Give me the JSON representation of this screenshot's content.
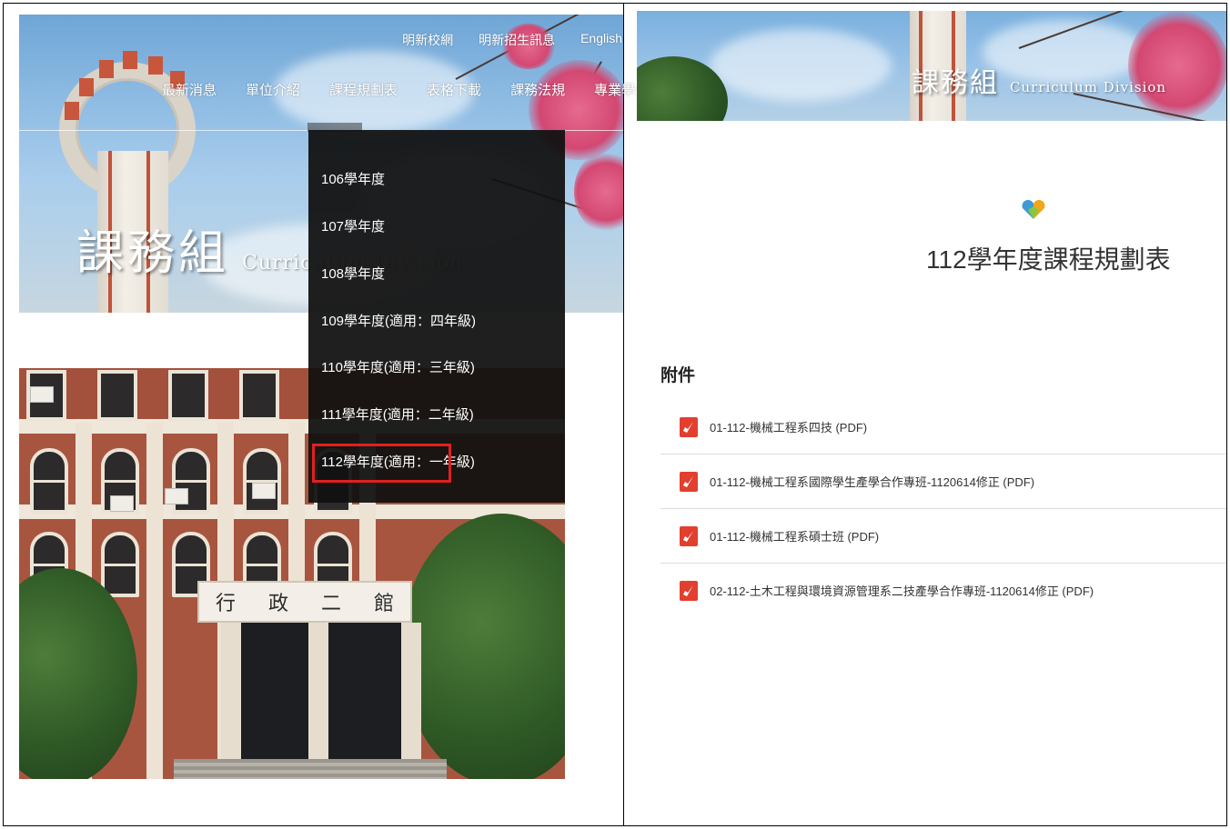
{
  "left_panel": {
    "utility_links": [
      "明新校網",
      "明新招生訊息",
      "English"
    ],
    "nav": [
      "最新消息",
      "單位介紹",
      "課程規劃表",
      "表格下載",
      "課務法規",
      "專業學分學程"
    ],
    "logo": {
      "cn": "課務組",
      "en": "Curriculum Division"
    },
    "dropdown": [
      "106學年度",
      "107學年度",
      "108學年度",
      "109學年度(適用：四年級)",
      "110學年度(適用：三年級)",
      "111學年度(適用：二年級)",
      "112學年度(適用：一年級)"
    ],
    "building_sign": [
      "行",
      "政",
      "二",
      "館"
    ]
  },
  "right_panel": {
    "logo": {
      "cn": "課務組",
      "en": "Curriculum Division"
    },
    "title": "112學年度課程規劃表",
    "attachments_heading": "附件",
    "attachments": [
      "01-112-機械工程系四技 (PDF)",
      "01-112-機械工程系國際學生產學合作專班-1120614修正 (PDF)",
      "01-112-機械工程系碩士班 (PDF)",
      "02-112-土木工程與環境資源管理系二技產學合作專班-1120614修正 (PDF)"
    ]
  },
  "colors": {
    "highlight": "#e0201f",
    "pdf_icon": "#e23f2f",
    "dropdown_bg": "#111111"
  }
}
